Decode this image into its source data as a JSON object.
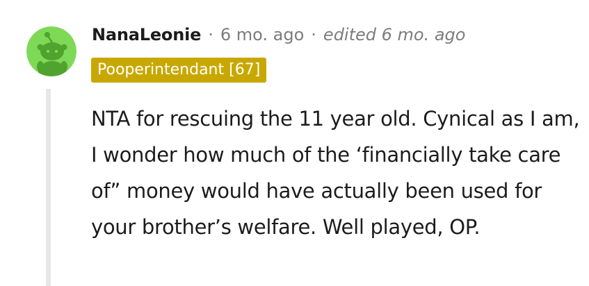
{
  "comment": {
    "author": "NanaLeonie",
    "separator": "·",
    "posted_time": "6 mo. ago",
    "edited_text": "edited 6 mo. ago",
    "flair": "Pooperintendant [67]",
    "body": "NTA for rescuing the 11 year old. Cynical as I am, I wonder how much of the ‘financially take care of” money would have actually been used for your brother’s welfare. Well played, OP."
  },
  "colors": {
    "avatar_background": "#7ed957",
    "avatar_figure": "#4fa32e",
    "flair_background": "#c8a800",
    "flair_text": "#ffffff",
    "meta_text": "#7c7c7c",
    "thread_line": "#e5e7e9"
  },
  "icons": {
    "avatar": "reddit-snoo-avatar-icon"
  }
}
